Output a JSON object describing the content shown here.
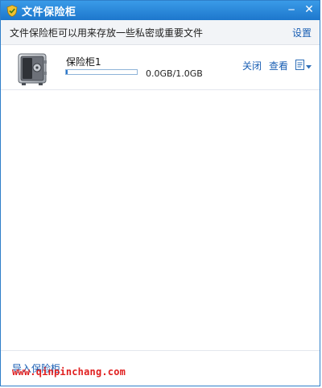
{
  "window": {
    "title": "文件保险柜",
    "icon": "shield-icon",
    "minimize_icon": "minimize-icon",
    "close_icon": "close-icon"
  },
  "infobar": {
    "description": "文件保险柜可以用来存放一些私密或重要文件",
    "settings_label": "设置"
  },
  "vaults": [
    {
      "name": "保险柜1",
      "size_text": "0.0GB/1.0GB",
      "usage_fraction": 0.02,
      "close_label": "关闭",
      "view_label": "查看",
      "icon": "safe-icon",
      "menu_icon": "document-menu-icon"
    }
  ],
  "footer": {
    "import_label": "导入保险柜",
    "watermark": "www.qinpinchang.com"
  },
  "colors": {
    "titlebar": "#1d77cc",
    "link": "#1a5fb4",
    "progress": "#2e78cc",
    "watermark": "#e02020"
  }
}
